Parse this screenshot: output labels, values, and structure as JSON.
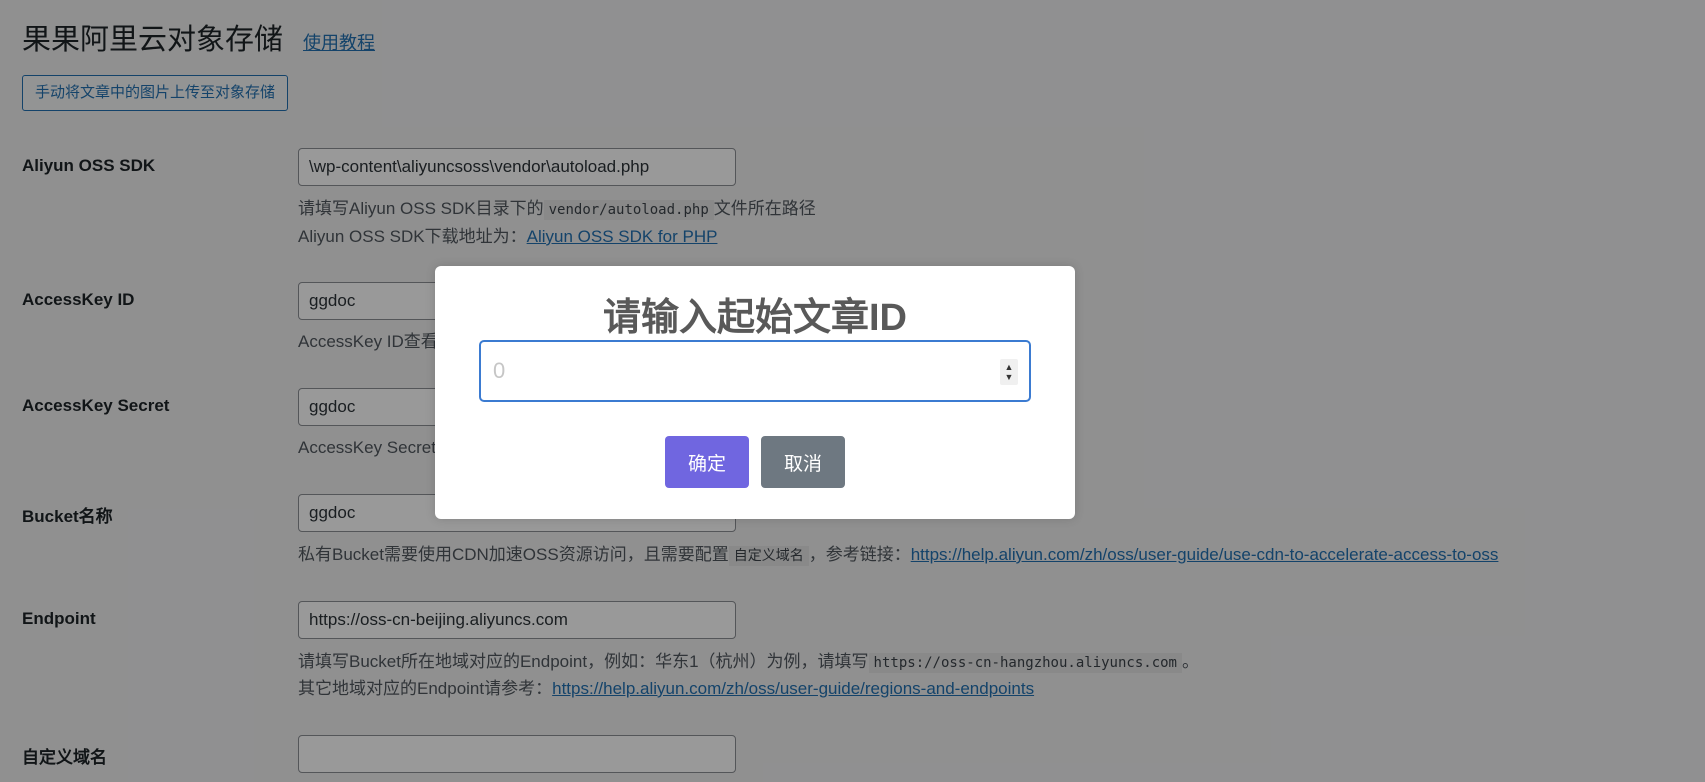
{
  "header": {
    "title": "果果阿里云对象存储",
    "tutorial_link": "使用教程",
    "upload_button": "手动将文章中的图片上传至对象存储"
  },
  "settings": {
    "sdk": {
      "label": "Aliyun OSS SDK",
      "value": "\\wp-content\\aliyuncsoss\\vendor\\autoload.php",
      "desc1_prefix": "请填写Aliyun OSS SDK目录下的",
      "desc1_code": "vendor/autoload.php",
      "desc1_suffix": "文件所在路径",
      "desc2_prefix": "Aliyun OSS SDK下载地址为：",
      "desc2_link": "Aliyun OSS SDK for PHP"
    },
    "access_key_id": {
      "label": "AccessKey ID",
      "value": "ggdoc",
      "desc": "AccessKey ID查看"
    },
    "access_key_secret": {
      "label": "AccessKey Secret",
      "value": "ggdoc",
      "desc": "AccessKey Secret查"
    },
    "bucket": {
      "label": "Bucket名称",
      "value": "ggdoc",
      "desc_prefix": "私有Bucket需要使用CDN加速OSS资源访问，且需要配置",
      "desc_code": "自定义域名",
      "desc_mid": "，参考链接：",
      "desc_link": "https://help.aliyun.com/zh/oss/user-guide/use-cdn-to-accelerate-access-to-oss"
    },
    "endpoint": {
      "label": "Endpoint",
      "value": "https://oss-cn-beijing.aliyuncs.com",
      "desc1_prefix": "请填写Bucket所在地域对应的Endpoint，例如：华东1（杭州）为例，请填写",
      "desc1_code": "https://oss-cn-hangzhou.aliyuncs.com",
      "desc1_suffix": "。",
      "desc2_prefix": "其它地域对应的Endpoint请参考：",
      "desc2_link": "https://help.aliyun.com/zh/oss/user-guide/regions-and-endpoints"
    },
    "custom_domain": {
      "label": "自定义域名",
      "value": ""
    }
  },
  "modal": {
    "title": "请输入起始文章ID",
    "input_placeholder": "0",
    "confirm_label": "确定",
    "cancel_label": "取消"
  },
  "colors": {
    "link": "#2271b1",
    "confirm_button": "#7066e0",
    "cancel_button": "#6e7881",
    "overlay": "rgba(0,0,0,0.4)"
  }
}
